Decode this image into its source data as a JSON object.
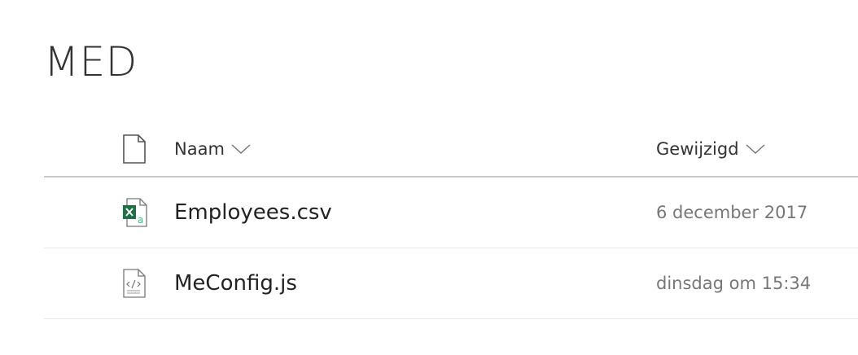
{
  "folder": {
    "title": "MED"
  },
  "columns": {
    "type_icon": "document-icon",
    "name_label": "Naam",
    "modified_label": "Gewijzigd"
  },
  "files": [
    {
      "name": "Employees.csv",
      "modified": "6 december 2017",
      "icon": "excel-csv-icon"
    },
    {
      "name": "MeConfig.js",
      "modified": "dinsdag om 15:34",
      "icon": "code-file-icon"
    }
  ],
  "colors": {
    "excel_green": "#1e7145",
    "excel_light_green": "#33c481"
  }
}
